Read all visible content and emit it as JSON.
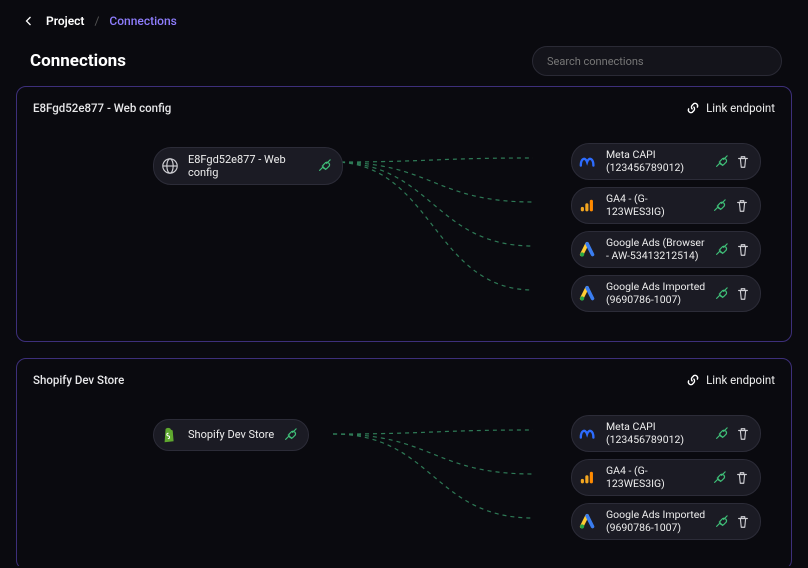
{
  "breadcrumb": {
    "project": "Project",
    "current": "Connections"
  },
  "heading": "Connections",
  "search_placeholder": "Search connections",
  "link_endpoint_label": "Link endpoint",
  "groups": [
    {
      "title": "E8Fgd52e877 - Web config",
      "source": {
        "icon": "globe",
        "label": "E8Fgd52e877 - Web config"
      },
      "destinations": [
        {
          "icon": "meta",
          "label": "Meta CAPI (123456789012)"
        },
        {
          "icon": "ga4",
          "label": "GA4 - (G-123WES3IG)"
        },
        {
          "icon": "gads",
          "label": "Google Ads (Browser - AW-53413212514)"
        },
        {
          "icon": "gads",
          "label": "Google Ads Imported (9690786-1007)"
        }
      ]
    },
    {
      "title": "Shopify Dev Store",
      "source": {
        "icon": "shopify",
        "label": "Shopify Dev Store"
      },
      "destinations": [
        {
          "icon": "meta",
          "label": "Meta CAPI (123456789012)"
        },
        {
          "icon": "ga4",
          "label": "GA4 - (G-123WES3IG)"
        },
        {
          "icon": "gads",
          "label": "Google Ads Imported (9690786-1007)"
        }
      ]
    }
  ]
}
